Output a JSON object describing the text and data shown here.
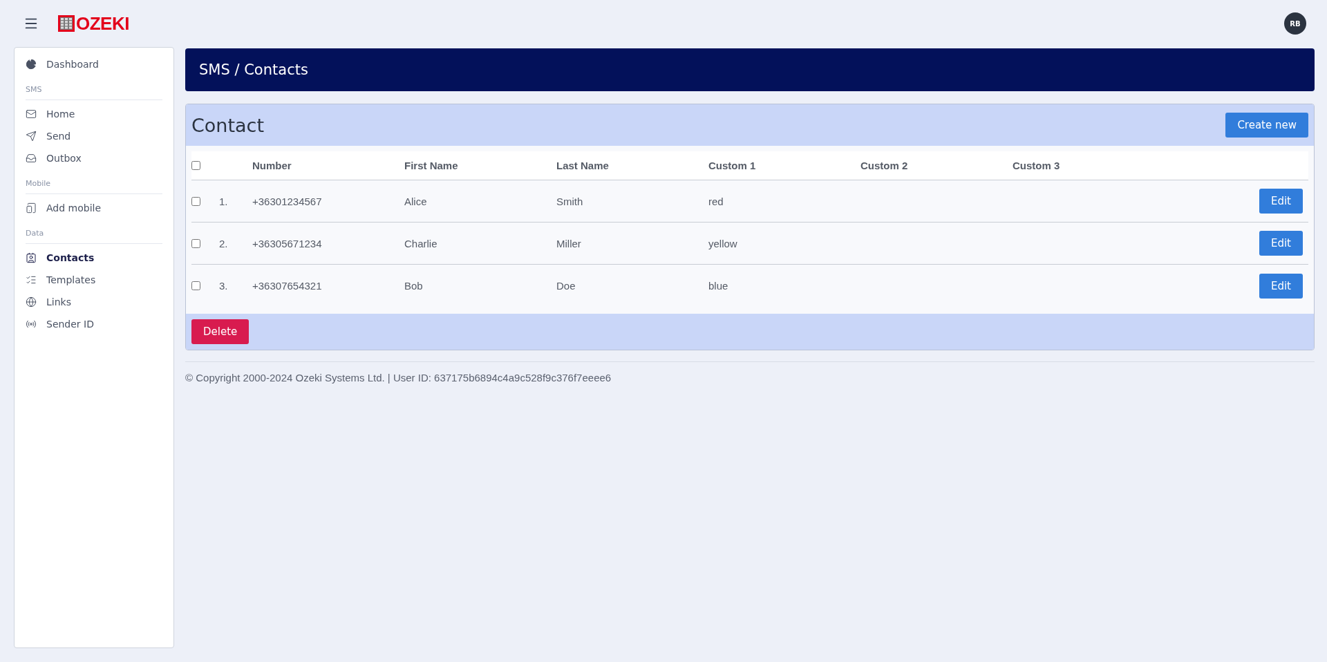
{
  "topbar": {
    "logo": "OZEKI",
    "avatar": "RB"
  },
  "sidebar": {
    "sections": [
      {
        "items": [
          {
            "label": "Dashboard",
            "selected": false
          }
        ]
      },
      {
        "title": "SMS",
        "items": [
          {
            "label": "Home",
            "selected": false
          },
          {
            "label": "Send",
            "selected": false
          },
          {
            "label": "Outbox",
            "selected": false
          }
        ]
      },
      {
        "title": "Mobile",
        "items": [
          {
            "label": "Add mobile",
            "selected": false
          }
        ]
      },
      {
        "title": "Data",
        "items": [
          {
            "label": "Contacts",
            "selected": true
          },
          {
            "label": "Templates",
            "selected": false
          },
          {
            "label": "Links",
            "selected": false
          },
          {
            "label": "Sender ID",
            "selected": false
          }
        ]
      }
    ]
  },
  "page_header": {
    "title": "SMS / Contacts"
  },
  "card": {
    "title": "Contact",
    "create_button": "Create new",
    "delete_button": "Delete",
    "table": {
      "select_all_checked": false,
      "columns": [
        "Number",
        "First Name",
        "Last Name",
        "Custom 1",
        "Custom 2",
        "Custom 3"
      ],
      "rows": [
        {
          "checked": false,
          "index": "1.",
          "cells": [
            "+36301234567",
            "Alice",
            "Smith",
            "red",
            "",
            ""
          ],
          "action": "Edit"
        },
        {
          "checked": false,
          "index": "2.",
          "cells": [
            "+36305671234",
            "Charlie",
            "Miller",
            "yellow",
            "",
            ""
          ],
          "action": "Edit"
        },
        {
          "checked": false,
          "index": "3.",
          "cells": [
            "+36307654321",
            "Bob",
            "Doe",
            "blue",
            "",
            ""
          ],
          "action": "Edit"
        }
      ]
    }
  },
  "footer": {
    "text": "© Copyright 2000-2024 Ozeki Systems Ltd. | User ID: 637175b6894c4a9c528f9c376f7eeee6"
  }
}
